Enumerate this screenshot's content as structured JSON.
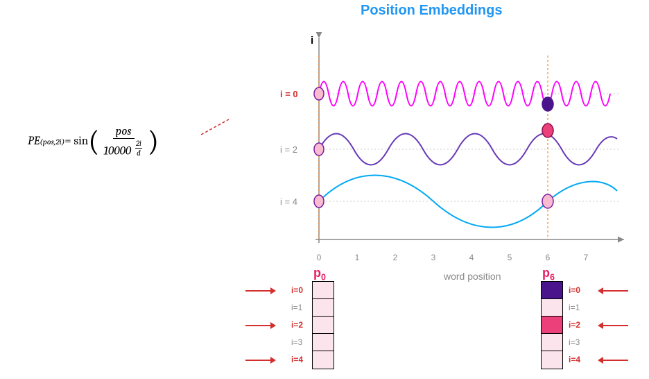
{
  "title": "Position Embeddings",
  "formula": {
    "lhs_main": "PE",
    "lhs_sub": "(pos,2i)",
    "eq": " = sin",
    "num": "pos",
    "den_base": "10000",
    "den_exp_num": "2i",
    "den_exp_den": "d"
  },
  "axis_label_i": "i",
  "wave_labels": {
    "i0": "i = 0",
    "i2": "i = 2",
    "i4": "i = 4"
  },
  "x_ticks": [
    "0",
    "1",
    "2",
    "3",
    "4",
    "5",
    "6",
    "7"
  ],
  "x_axis_label": "word position",
  "p_labels": {
    "p0_main": "p",
    "p0_sub": "0",
    "p6_main": "p",
    "p6_sub": "6"
  },
  "row_labels": [
    "i=0",
    "i=1",
    "i=2",
    "i=3",
    "i=4"
  ],
  "chart_data": {
    "type": "diagram",
    "description": "Sinusoidal positional embedding waves for dimensions i=0,2,4 sampled at pos=0 and pos=6",
    "waves": [
      {
        "i": 0,
        "color": "#ff00ff",
        "frequency_relative": "high",
        "period_approx": 0.5
      },
      {
        "i": 2,
        "color": "#673ab7",
        "frequency_relative": "medium",
        "period_approx": 1.8
      },
      {
        "i": 4,
        "color": "#03a9f4",
        "frequency_relative": "low",
        "period_approx": 6.0
      }
    ],
    "sampled_positions": [
      0,
      6
    ],
    "vectors": {
      "p0_colors": [
        "#fce4ec",
        "#fce4ec",
        "#fce4ec",
        "#fce4ec",
        "#fce4ec"
      ],
      "p6_colors": [
        "#4a148c",
        "#fce4ec",
        "#ec407a",
        "#fce4ec",
        "#fce4ec"
      ]
    },
    "marker_points_at_pos6": [
      {
        "i": 0,
        "y_relative": "upper",
        "color": "#4a148c"
      },
      {
        "i": 2,
        "y_relative": "upper",
        "color": "#ec407a"
      },
      {
        "i": 4,
        "y_relative": "baseline",
        "color": "#f8bbd0"
      }
    ]
  }
}
